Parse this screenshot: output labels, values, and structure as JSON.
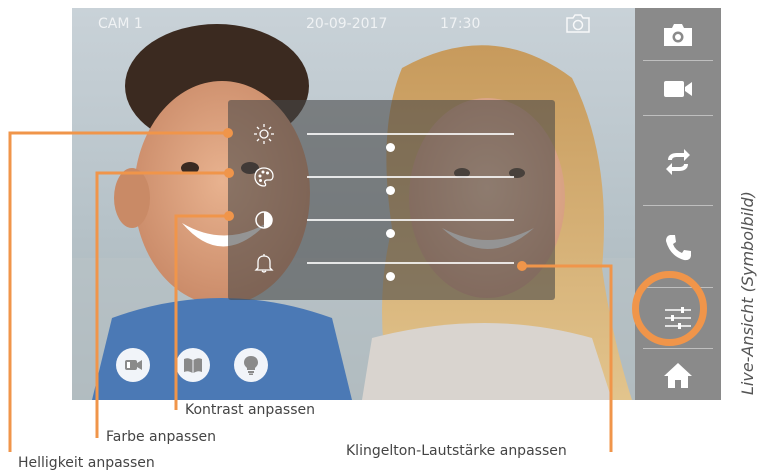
{
  "screen": {
    "cam_label": "CAM 1",
    "date": "20-09-2017",
    "time": "17:30"
  },
  "icons": {
    "snapshot": "camera-outline-icon",
    "bottom": [
      "video-doorbell-icon",
      "book-icon",
      "light-bulb-icon"
    ],
    "sidebar": [
      "camera-icon",
      "video-record-icon",
      "switch-arrows-icon",
      "phone-icon",
      "sliders-icon",
      "home-icon"
    ]
  },
  "settings": [
    {
      "name": "brightness",
      "icon": "sun-icon",
      "level": 0.4
    },
    {
      "name": "color",
      "icon": "palette-icon",
      "level": 0.4
    },
    {
      "name": "contrast",
      "icon": "contrast-icon",
      "level": 0.4
    },
    {
      "name": "ringtone-volume",
      "icon": "bell-icon",
      "level": 0.4
    }
  ],
  "caption": "Live-Ansicht (Symbolbild)",
  "callouts": {
    "brightness": "Helligkeit anpassen",
    "color": "Farbe anpassen",
    "contrast": "Kontrast anpassen",
    "volume": "Klingelton-Lautstärke anpassen"
  },
  "colors": {
    "accent": "#f0954a",
    "sidebar": "#8a8a8a"
  }
}
